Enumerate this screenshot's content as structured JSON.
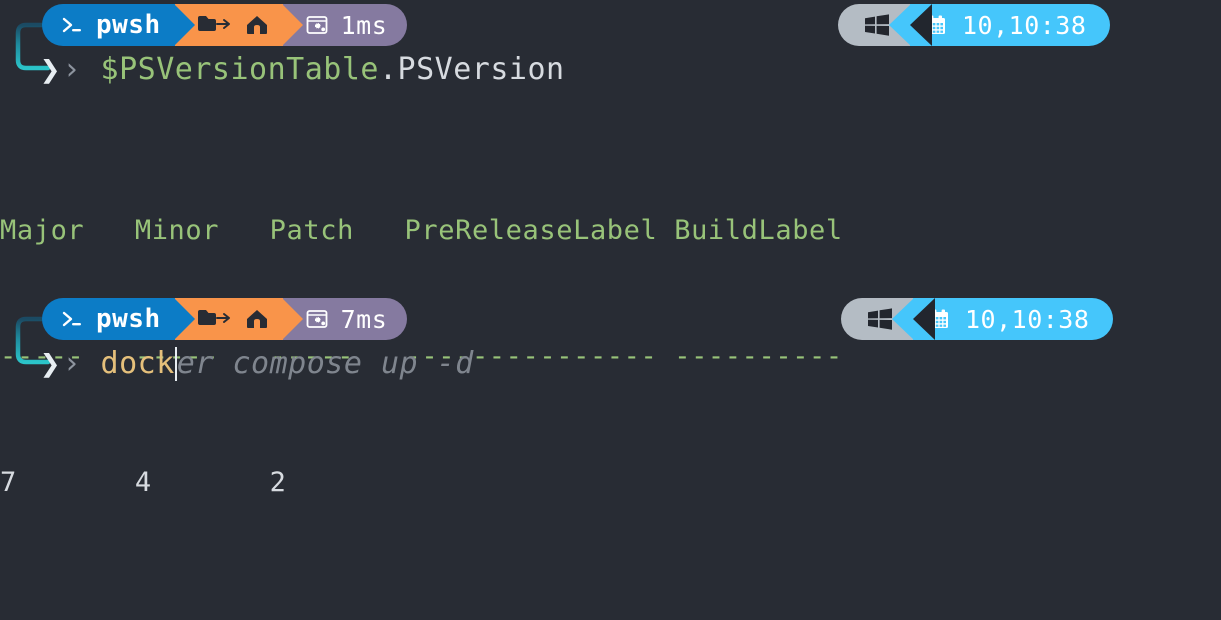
{
  "terminal": {
    "background_color": "#282c34",
    "shell": "pwsh"
  },
  "colors": {
    "shell_segment": "#0c7cc6",
    "path_segment": "#f9944a",
    "time_segment": "#857aa0",
    "os_segment": "#b4bcc4",
    "clock_segment": "#45c6fb",
    "prompt_green": "#98c379",
    "prompt_white": "#d7dbe0",
    "typed_gold": "#e5c07b",
    "ghost_gray": "#7f858e",
    "elbow_cyan": "#2bc4c9"
  },
  "blocks": [
    {
      "left_prompt": {
        "shell_icon": "terminal-prompt-icon",
        "shell_label": "pwsh",
        "path_icons": [
          "folder-arrow-icon",
          "home-icon"
        ],
        "duration_icon": "execution-timer-icon",
        "duration_label": "1ms"
      },
      "right_prompt": {
        "os_icon": "windows-logo-icon",
        "clock_icon": "calendar-icon",
        "clock_label": "10,10:38"
      },
      "input": {
        "chevron_thick": "❯",
        "chevron_thin": "›",
        "command_variable": "$PSVersionTable",
        "command_member": ".PSVersion",
        "ghost_suggestion": ""
      }
    },
    {
      "left_prompt": {
        "shell_icon": "terminal-prompt-icon",
        "shell_label": "pwsh",
        "path_icons": [
          "folder-arrow-icon",
          "home-icon"
        ],
        "duration_icon": "execution-timer-icon",
        "duration_label": "7ms"
      },
      "right_prompt": {
        "os_icon": "windows-logo-icon",
        "clock_icon": "calendar-icon",
        "clock_label": "10,10:38"
      },
      "input": {
        "chevron_thick": "❯",
        "chevron_thin": "›",
        "typed_text": "dock",
        "ghost_suggestion": "er compose up -d"
      }
    }
  ],
  "output": {
    "headers": "Major   Minor   Patch   PreReleaseLabel BuildLabel",
    "rules": "-----   -----   -----   --------------- ----------",
    "row": "7       4       2"
  }
}
